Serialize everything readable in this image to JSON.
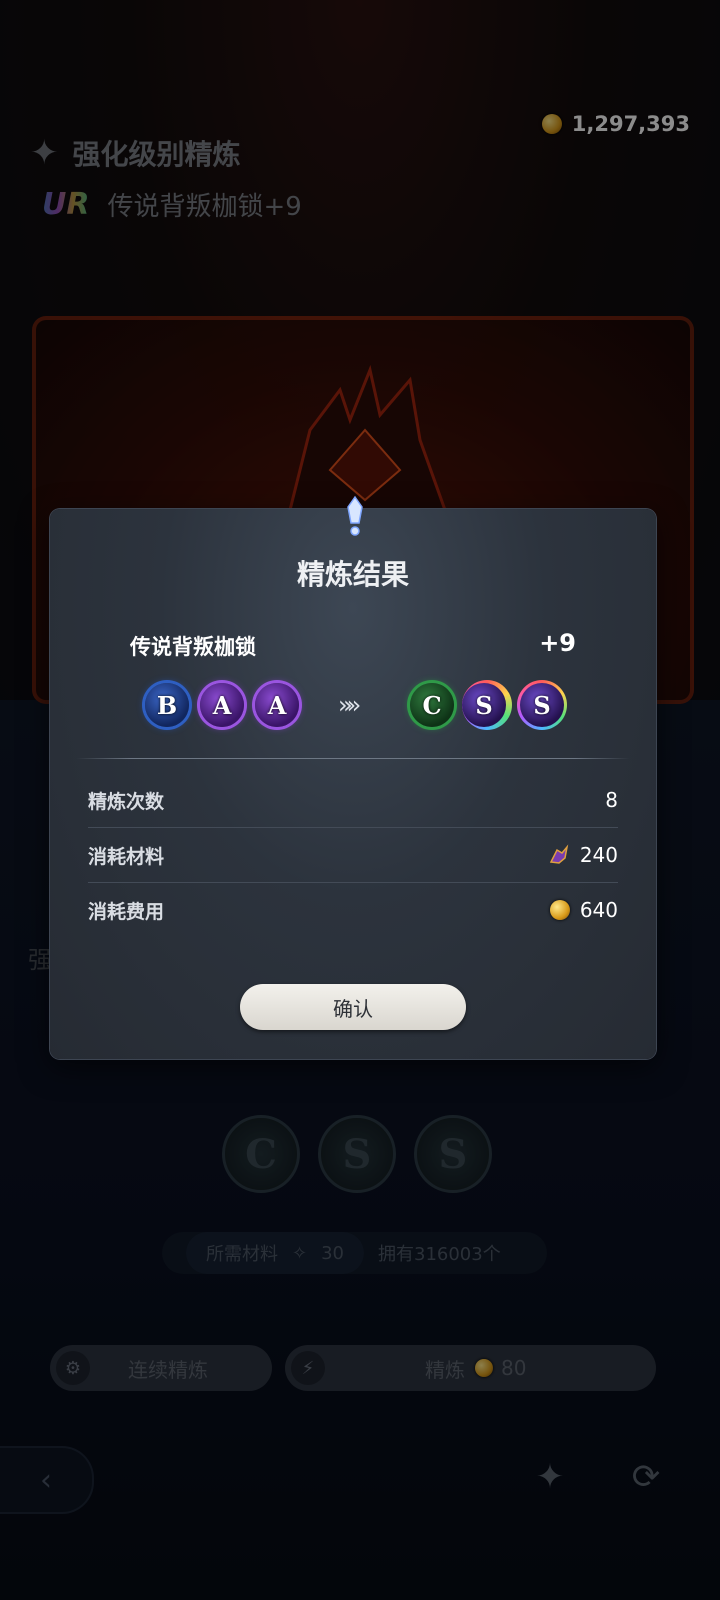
{
  "header": {
    "gold": "1,297,393",
    "title": "强化级别精炼",
    "rarity_badge": "UR",
    "item_subtitle": "传说背叛枷锁+9",
    "title_icon": "sparkle-hammer-icon"
  },
  "background": {
    "slots": [
      "C",
      "S",
      "S"
    ],
    "required_label": "所需材料",
    "required_count": "30",
    "owned_text": "拥有316003个",
    "side_ghost_text": "强",
    "continuous_refine_label": "连续精炼",
    "refine_label": "精炼",
    "refine_cost": "80"
  },
  "modal": {
    "title": "精炼结果",
    "item_name": "传说背叛枷锁",
    "item_level": "+9",
    "before_grades": [
      "B",
      "A",
      "A"
    ],
    "after_grades": [
      "C",
      "S",
      "S"
    ],
    "arrow": "»»",
    "stats": [
      {
        "label": "精炼次数",
        "value": "8",
        "icon": ""
      },
      {
        "label": "消耗材料",
        "value": "240",
        "icon": "material-icon"
      },
      {
        "label": "消耗费用",
        "value": "640",
        "icon": "gold-coin-icon"
      }
    ],
    "confirm_label": "确认"
  },
  "colors": {
    "grade_b": "#2e5fc2",
    "grade_a": "#9a55e0",
    "grade_c": "#2f9a48",
    "gold": "#d89a1a"
  }
}
